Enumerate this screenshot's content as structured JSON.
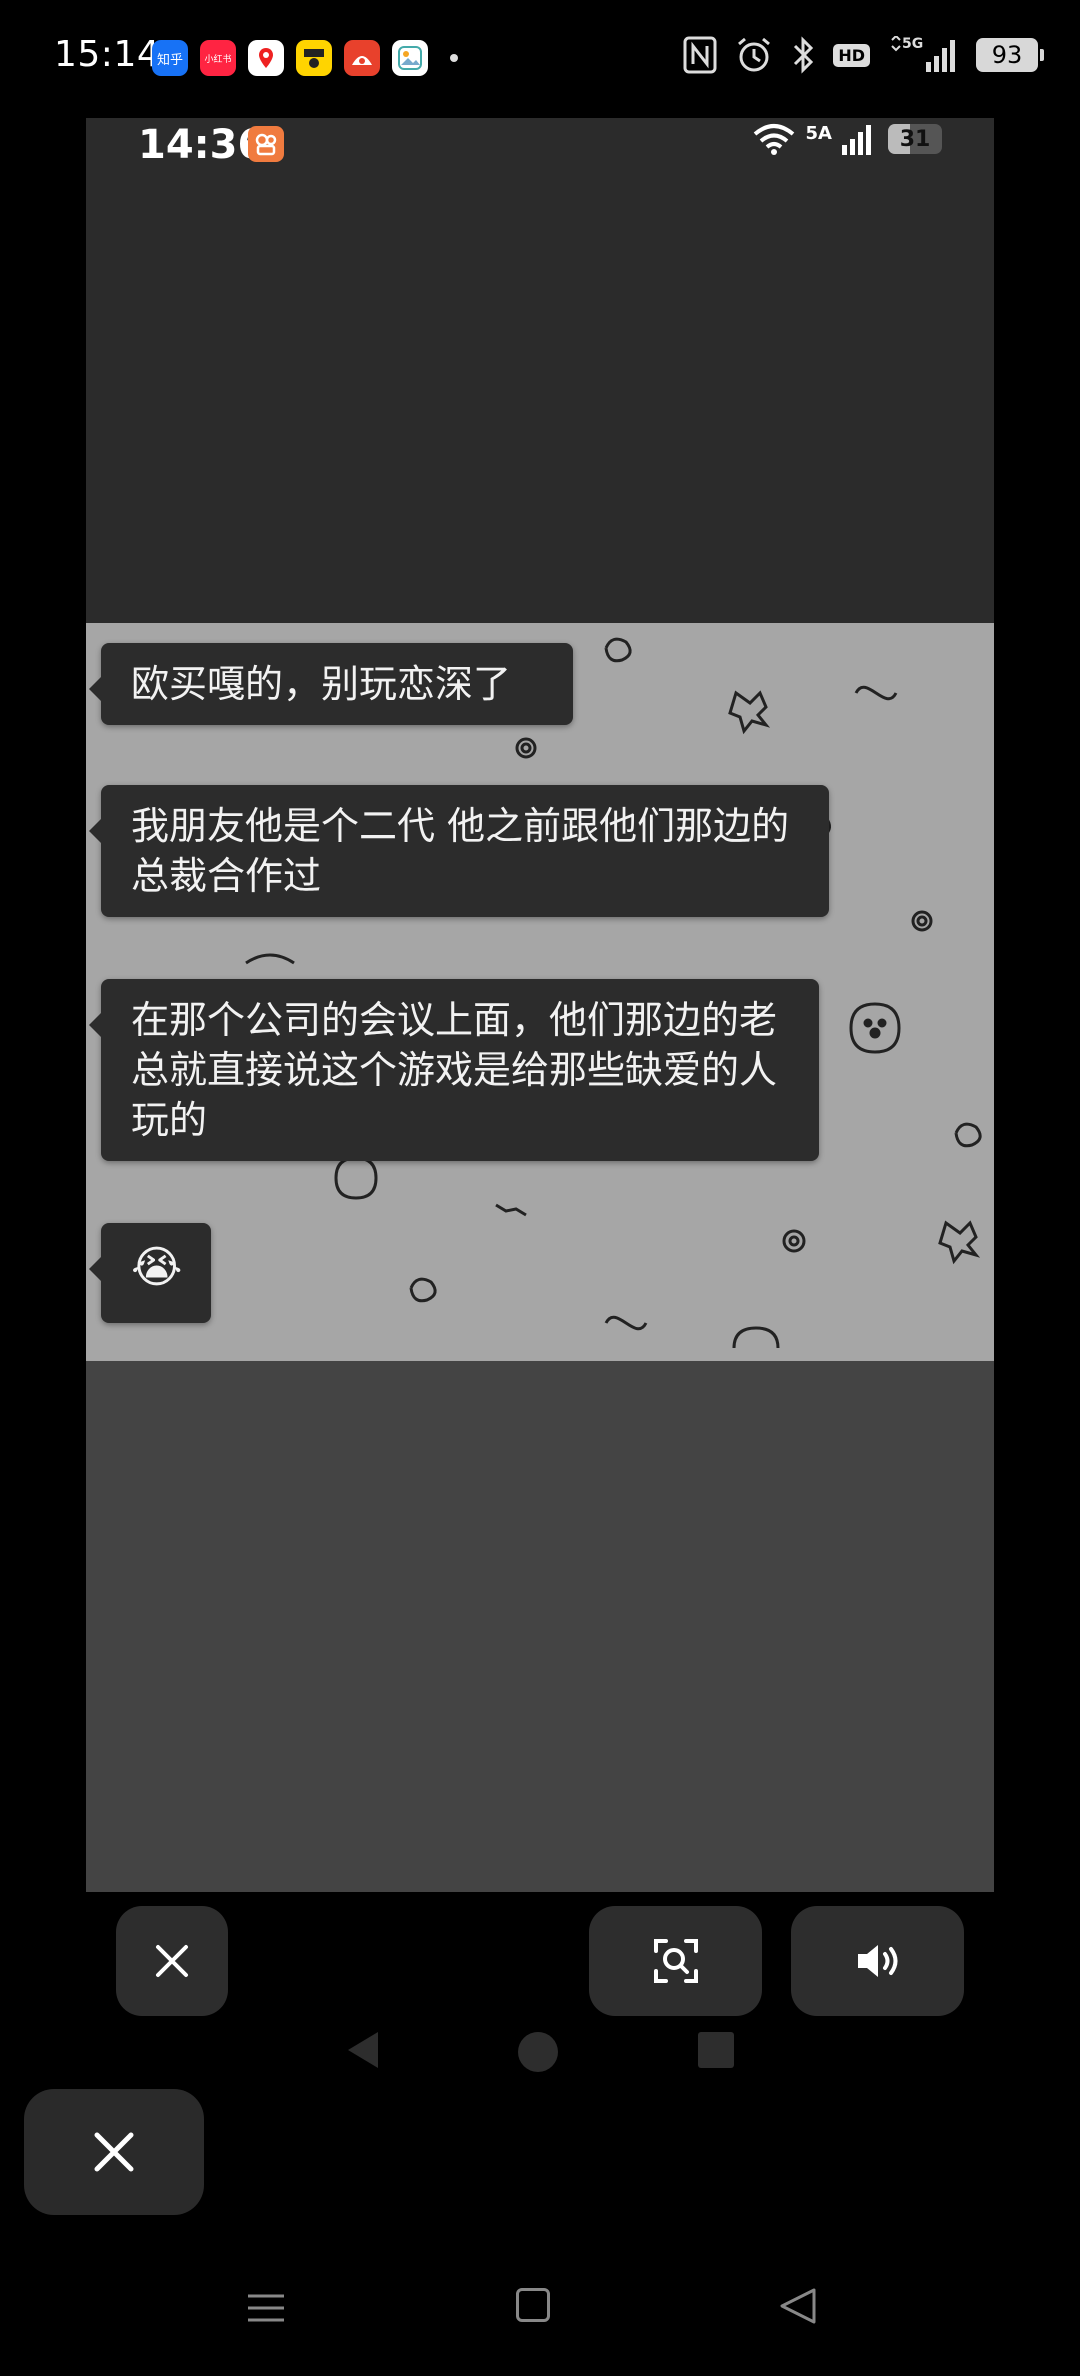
{
  "outer_status": {
    "time": "15:14",
    "apps": [
      {
        "name": "zhihu-app-icon",
        "label": "知乎"
      },
      {
        "name": "xiaohongshu-app-icon",
        "label": "小红书"
      },
      {
        "name": "map-app-icon",
        "label": ""
      },
      {
        "name": "yellow-app-icon",
        "label": ""
      },
      {
        "name": "red-app-icon",
        "label": ""
      },
      {
        "name": "photo-app-icon",
        "label": ""
      }
    ],
    "network": "5G",
    "hd": "HD",
    "battery": "93"
  },
  "inner_status": {
    "time": "14:36",
    "network": "5A",
    "battery": "31"
  },
  "chat": {
    "messages": [
      {
        "text": "欧买嘎的，别玩恋深了"
      },
      {
        "text": "我朋友他是个二代 他之前跟他们那边的总裁合作过"
      },
      {
        "text": "在那个公司的会议上面，他们那边的老总就直接说这个游戏是给那些缺爱的人玩的"
      },
      {
        "text": "😭"
      }
    ]
  },
  "colors": {
    "background": "#000000",
    "inner_bg": "#2b2b2b",
    "chat_bg": "#a6a6a6",
    "bubble": "#2c2c2c",
    "button": "#2d2d2d"
  },
  "icons": {
    "close": "close-icon",
    "scan": "scan-icon",
    "sound": "speaker-icon"
  }
}
